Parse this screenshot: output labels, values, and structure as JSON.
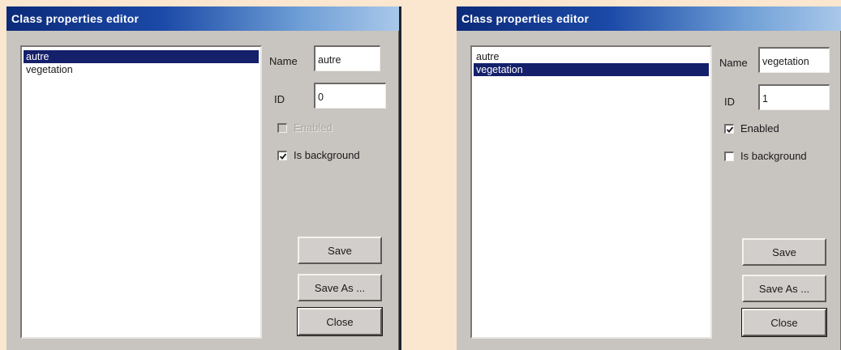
{
  "left": {
    "title": "Class properties editor",
    "list": [
      {
        "label": "autre",
        "selected": true
      },
      {
        "label": "vegetation",
        "selected": false
      }
    ],
    "name_label": "Name",
    "name_value": "autre",
    "id_label": "ID",
    "id_value": "0",
    "enabled_label": "Enabled",
    "enabled_checked": false,
    "enabled_disabled": true,
    "background_label": "Is background",
    "background_checked": true,
    "save_label": "Save",
    "save_as_label": "Save As ...",
    "close_label": "Close"
  },
  "right": {
    "title": "Class properties editor",
    "list": [
      {
        "label": "autre",
        "selected": false
      },
      {
        "label": "vegetation",
        "selected": true
      }
    ],
    "name_label": "Name",
    "name_value": "vegetation",
    "id_label": "ID",
    "id_value": "1",
    "enabled_label": "Enabled",
    "enabled_checked": true,
    "enabled_disabled": false,
    "background_label": "Is background",
    "background_checked": false,
    "save_label": "Save",
    "save_as_label": "Save As ...",
    "close_label": "Close"
  },
  "colors": {
    "desktop": "#fbe6cf",
    "window_face": "#c8c4c0",
    "selection": "#14206a",
    "title_start": "#0b2a7a"
  }
}
